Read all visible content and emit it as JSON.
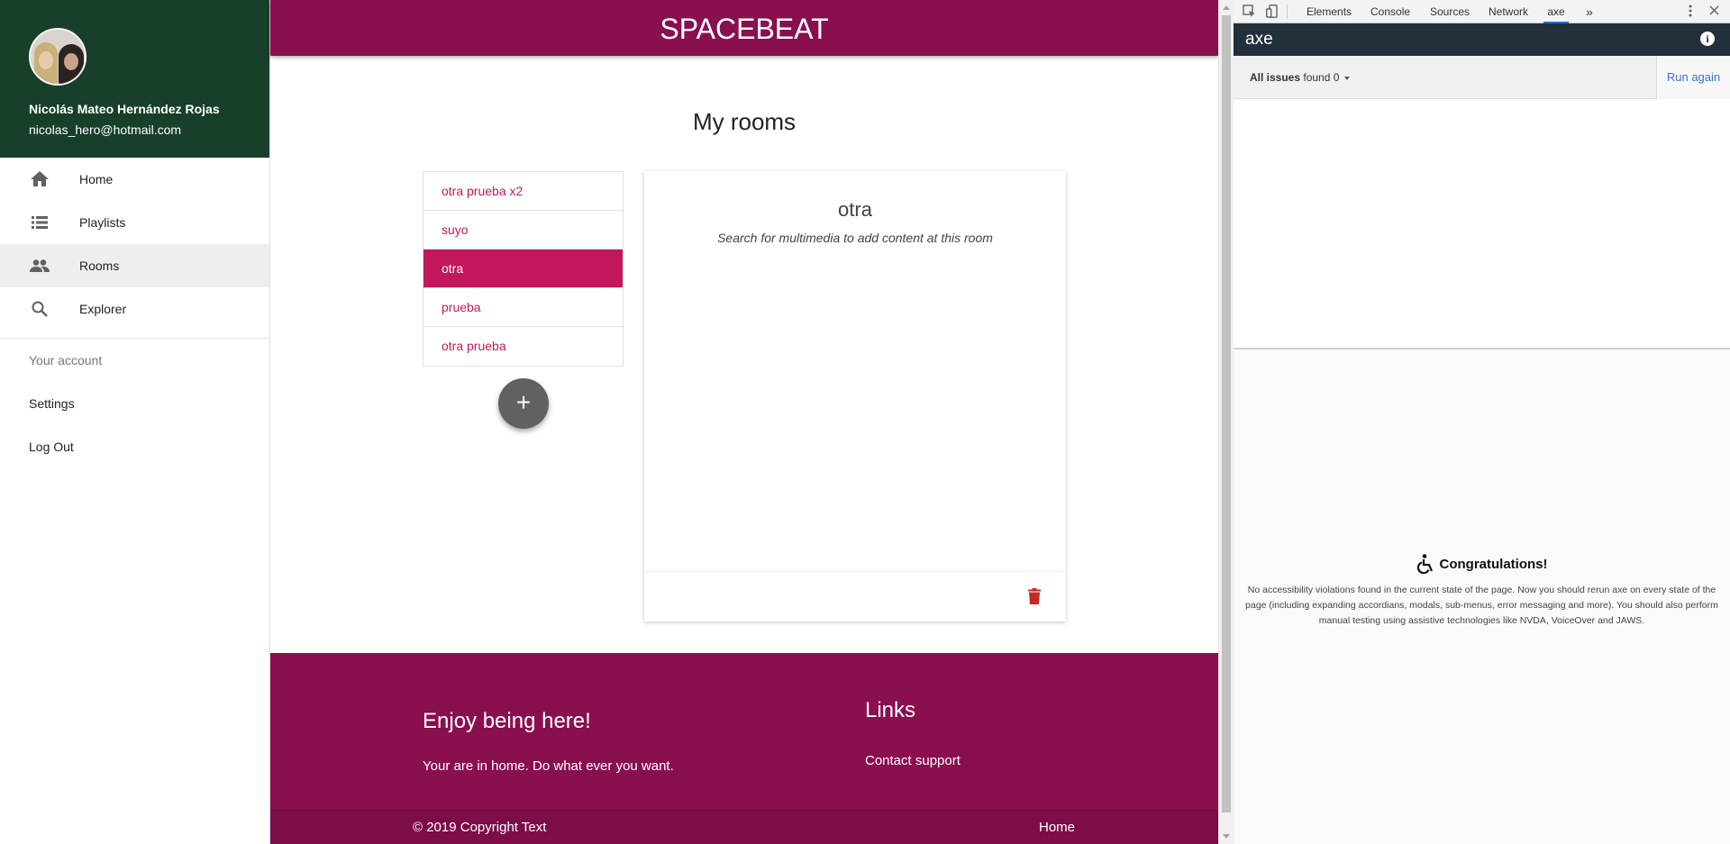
{
  "sidebar": {
    "user_name": "Nicolás Mateo Hernández Rojas",
    "user_email": "nicolas_hero@hotmail.com",
    "nav": [
      {
        "label": "Home",
        "icon": "home-icon"
      },
      {
        "label": "Playlists",
        "icon": "list-icon"
      },
      {
        "label": "Rooms",
        "icon": "people-icon",
        "active": true
      },
      {
        "label": "Explorer",
        "icon": "search-icon"
      }
    ],
    "account_header": "Your account",
    "account": [
      {
        "label": "Settings"
      },
      {
        "label": "Log Out"
      }
    ]
  },
  "header": {
    "title": "SPACEBEAT"
  },
  "main": {
    "page_title": "My rooms",
    "rooms": [
      "otra prueba x2",
      "suyo",
      "otra",
      "prueba",
      "otra prueba"
    ],
    "selected_room_index": 2,
    "add_button_label": "+",
    "room_detail": {
      "title": "otra",
      "hint": "Search for multimedia to add content at this room"
    }
  },
  "footer": {
    "heading": "Enjoy being here!",
    "text": "Your are in home. Do what ever you want.",
    "links_heading": "Links",
    "contact": "Contact support",
    "copyright": "© 2019 Copyright Text",
    "home_link": "Home"
  },
  "devtools": {
    "tabs": [
      "Elements",
      "Console",
      "Sources",
      "Network",
      "axe"
    ],
    "active_tab": "axe",
    "more": "»",
    "axe": {
      "title": "axe",
      "all_issues": "All issues",
      "found_label": "found 0",
      "run_again": "Run again",
      "congrats_title": "Congratulations!",
      "congrats_text": "No accessibility violations found in the current state of the page. Now you should rerun axe on every state of the page (including expanding accordians, modals, sub-menus, error messaging and more). You should also perform manual testing using assistive technologies like NVDA, VoiceOver and JAWS."
    }
  },
  "colors": {
    "brand": "#8a0f4e",
    "accent": "#c2185b",
    "sidebar_header": "#173f2a",
    "axe_bar": "#22303b"
  }
}
